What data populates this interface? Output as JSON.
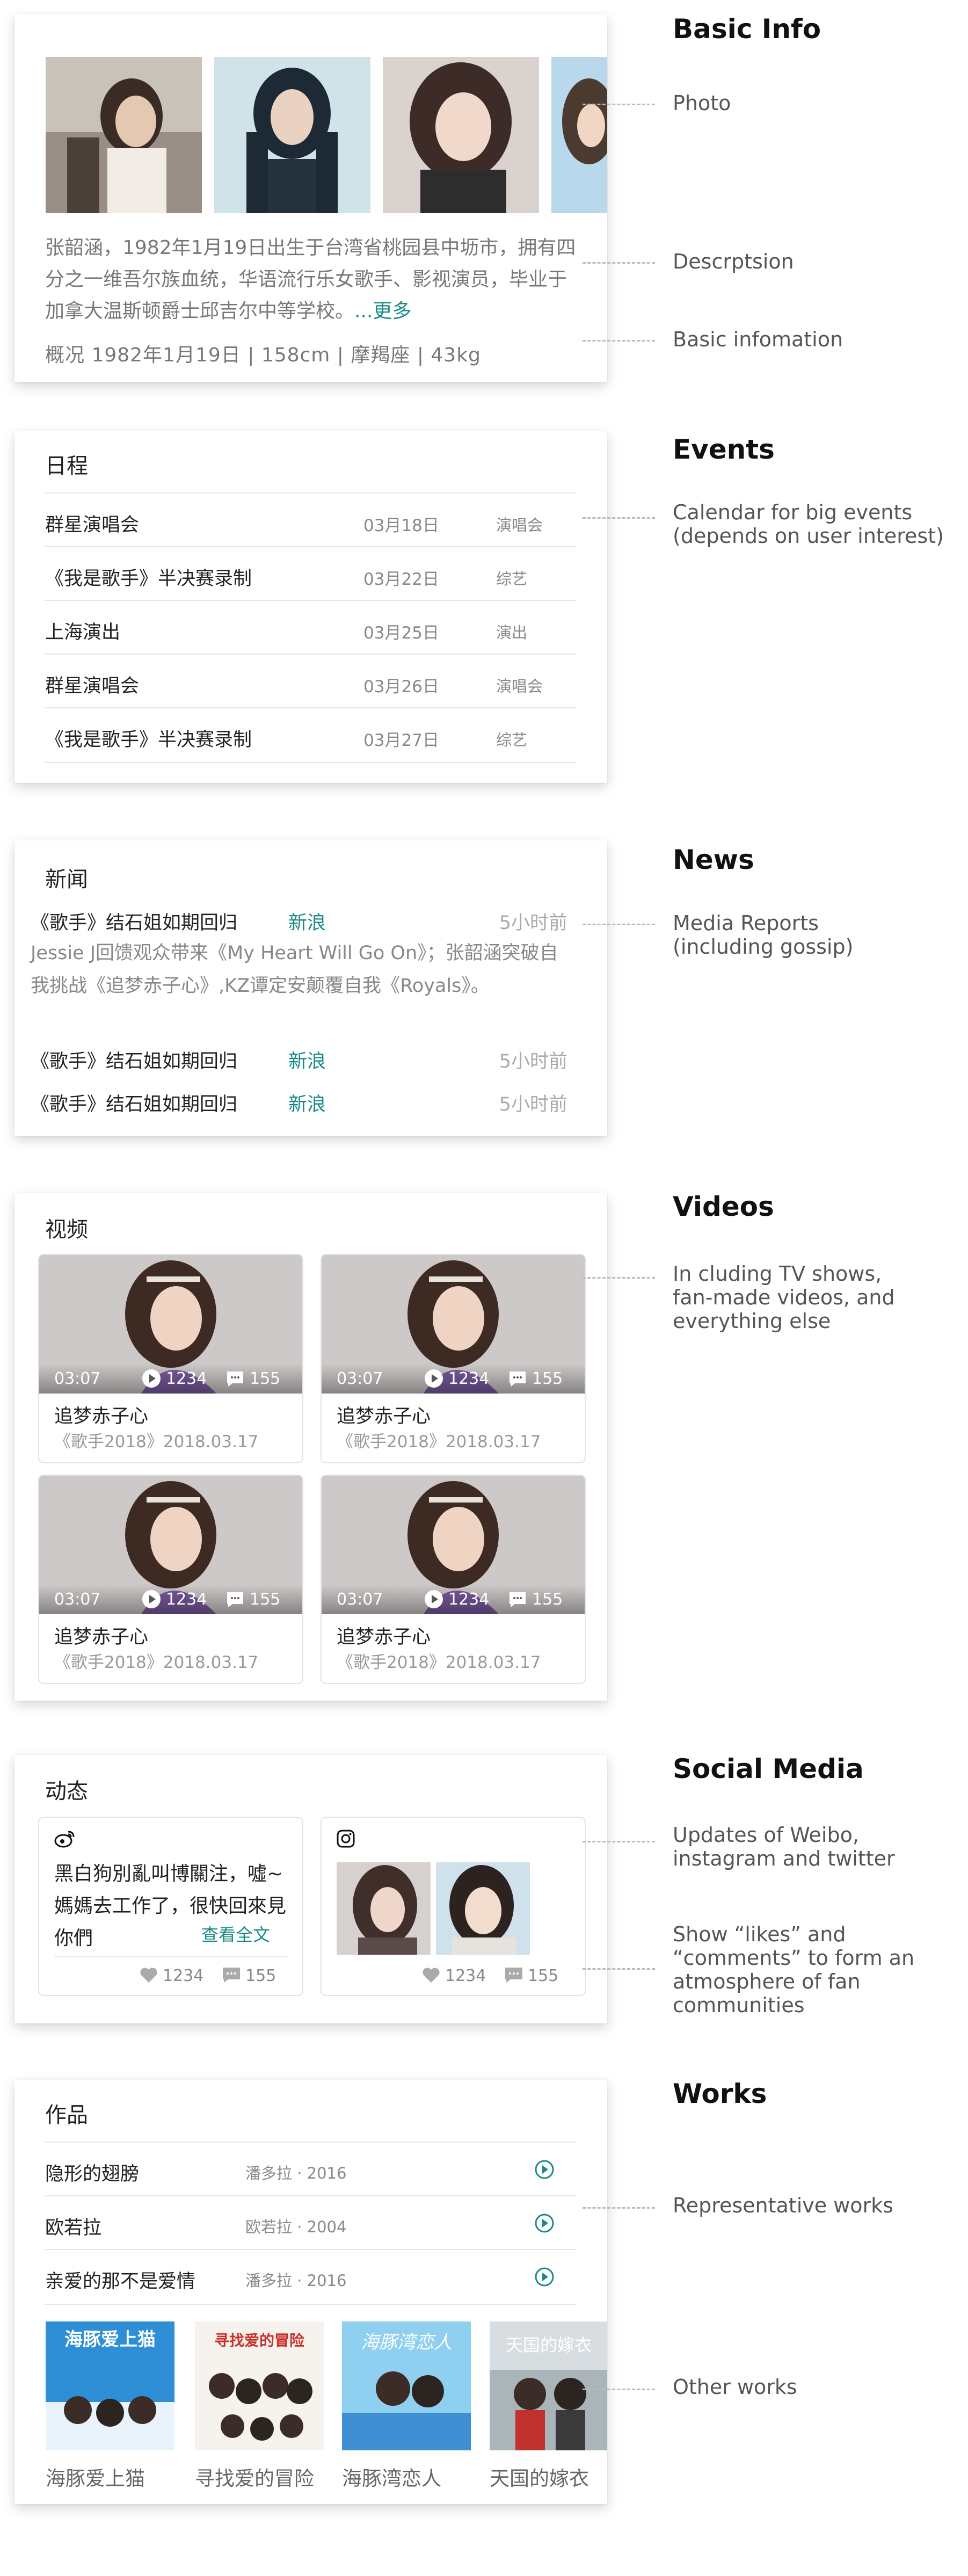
{
  "basic": {
    "section": "Basic Info",
    "desc": "张韶涵，1982年1月19日出生于台湾省桃园县中坜市，拥有四分之一维吾尔族血统，华语流行乐女歌手、影视演员，毕业于加拿大温斯顿爵士邱吉尔中等学校。",
    "more": "...更多",
    "facts": "概况 1982年1月19日 | 158cm | 摩羯座 | 43kg"
  },
  "annotations": {
    "photo": "Photo",
    "desc": "Descrptsion",
    "info": "Basic infomation",
    "events": "Calendar for big events\n  (depends on user interest)",
    "news": "Media Reports\n(including gossip)",
    "videos": "In cluding TV shows,\nfan-made videos, and\neverything else",
    "social1": "Updates of Weibo,\ninstagram and twitter",
    "social2": "Show “likes” and\n“comments” to form an\natmosphere of fan\ncommunities",
    "works1": "Representative works",
    "works2": "Other works"
  },
  "events": {
    "section": "Events",
    "title": "日程",
    "rows": [
      {
        "name": "群星演唱会",
        "date": "03月18日",
        "tag": "演唱会"
      },
      {
        "name": "《我是歌手》半决赛录制",
        "date": "03月22日",
        "tag": "综艺"
      },
      {
        "name": "上海演出",
        "date": "03月25日",
        "tag": "演出"
      },
      {
        "name": "群星演唱会",
        "date": "03月26日",
        "tag": "演唱会"
      },
      {
        "name": "《我是歌手》半决赛录制",
        "date": "03月27日",
        "tag": "综艺"
      }
    ]
  },
  "news": {
    "section": "News",
    "title": "新闻",
    "items": [
      {
        "title": "《歌手》结石姐如期回归",
        "source": "新浪",
        "time": "5小时前"
      },
      {
        "title": "《歌手》结石姐如期回归",
        "source": "新浪",
        "time": "5小时前"
      },
      {
        "title": "《歌手》结石姐如期回归",
        "source": "新浪",
        "time": "5小时前"
      }
    ],
    "body": "Jessie J回馈观众带来《My Heart Will Go On》；张韶涵突破自我挑战《追梦赤子心》,KZ谭定安颠覆自我《Royals》。"
  },
  "videos": {
    "section": "Videos",
    "title": "视频",
    "items": [
      {
        "duration": "03:07",
        "plays": "1234",
        "comments": "155",
        "title": "追梦赤子心",
        "subtitle": "《歌手2018》2018.03.17"
      },
      {
        "duration": "03:07",
        "plays": "1234",
        "comments": "155",
        "title": "追梦赤子心",
        "subtitle": "《歌手2018》2018.03.17"
      },
      {
        "duration": "03:07",
        "plays": "1234",
        "comments": "155",
        "title": "追梦赤子心",
        "subtitle": "《歌手2018》2018.03.17"
      },
      {
        "duration": "03:07",
        "plays": "1234",
        "comments": "155",
        "title": "追梦赤子心",
        "subtitle": "《歌手2018》2018.03.17"
      }
    ]
  },
  "social": {
    "section": "Social Media",
    "title": "动态",
    "weibo": {
      "text": "黑白狗別亂叫博關注，噓~媽媽去工作了，很快回來見你們",
      "link": "查看全文",
      "likes": "1234",
      "comments": "155"
    },
    "instagram": {
      "likes": "1234",
      "comments": "155"
    }
  },
  "works": {
    "section": "Works",
    "title": "作品",
    "rows": [
      {
        "name": "隐形的翅膀",
        "meta": "潘多拉 · 2016"
      },
      {
        "name": "欧若拉",
        "meta": "欧若拉 · 2004"
      },
      {
        "name": "亲爱的那不是爱情",
        "meta": "潘多拉 · 2016"
      }
    ],
    "posters": [
      {
        "title": "海豚爱上猫",
        "art": "海豚爱上猫"
      },
      {
        "title": "寻找爱的冒险",
        "art": "寻找爱的冒险"
      },
      {
        "title": "海豚湾恋人",
        "art": "海豚湾恋人"
      },
      {
        "title": "天国的嫁衣",
        "art": "天国的嫁衣"
      }
    ]
  },
  "colors": {
    "accent": "#1a8a88",
    "muted": "#888888"
  }
}
